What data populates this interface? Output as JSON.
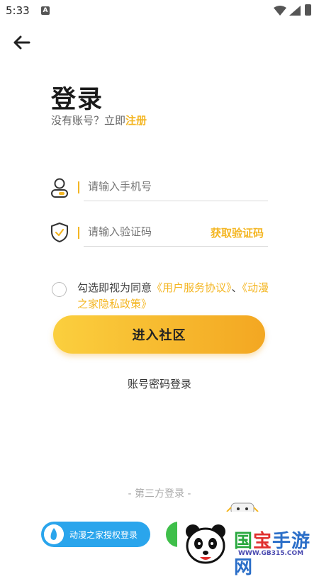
{
  "status_bar": {
    "time": "5:33",
    "notif_letter": "A"
  },
  "header": {
    "title": "登录",
    "subtitle_prefix": "没有账号？立即",
    "subtitle_link": "注册"
  },
  "form": {
    "phone_placeholder": "请输入手机号",
    "code_placeholder": "请输入验证码",
    "get_code_label": "获取验证码"
  },
  "agreement": {
    "prefix": "勾选即视为同意",
    "link1": "《用户服务协议》",
    "separator": "、",
    "link2": "《动漫之家隐私政策》",
    "checked": false
  },
  "actions": {
    "enter_label": "进入社区",
    "password_login_label": "账号密码登录"
  },
  "third_party": {
    "title": "- 第三方登录 -",
    "dmzj_label": "动漫之家授权登录"
  },
  "watermark": {
    "text_part1": "国",
    "text_part2": "宝",
    "text_part3": "手游网",
    "url": "WWW.GB315.COM"
  },
  "colors": {
    "accent": "#f4b623",
    "button_start": "#fbcf3e",
    "button_end": "#f3a722",
    "dmzj_blue": "#2aa5ec",
    "wechat_green": "#3fbf4a"
  }
}
